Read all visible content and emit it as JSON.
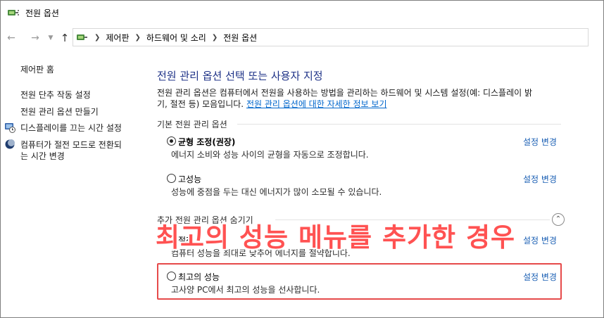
{
  "window": {
    "title": "전원 옵션"
  },
  "breadcrumb": {
    "items": [
      "제어판",
      "하드웨어 및 소리",
      "전원 옵션"
    ]
  },
  "sidebar": {
    "home": "제어판 홈",
    "links": [
      {
        "label": "전원 단추 작동 설정",
        "icon": null
      },
      {
        "label": "전원 관리 옵션 만들기",
        "icon": null
      },
      {
        "label": "디스플레이를 끄는 시간 설정",
        "icon": "display-clock-icon"
      },
      {
        "label": "컴퓨터가 절전 모드로 전환되",
        "label2": "는 시간 변경",
        "icon": "moon-icon"
      }
    ]
  },
  "main": {
    "heading": "전원 관리 옵션 선택 또는 사용자 지정",
    "description_line1": "전원 관리 옵션은 컴퓨터에서 전원을 사용하는 방법을 관리하는 하드웨어 및 시스템 설정(예: 디스플레이 밝",
    "description_line2": "기, 절전 등) 모음입니다.",
    "more_info_link": "전원 관리 옵션에 대한 자세한 정보 보기",
    "basic_group_label": "기본 전원 관리 옵션",
    "hidden_group_label": "추가 전원 관리 옵션 숨기기",
    "change_label": "설정 변경",
    "plans": [
      {
        "name": "균형 조정(권장)",
        "desc": "에너지 소비와 성능 사이의 균형을 자동으로 조정합니다.",
        "selected": true
      },
      {
        "name": "고성능",
        "desc": "성능에 중점을 두는 대신 에너지가 많이 소모될 수 있습니다.",
        "selected": false
      },
      {
        "name": "절전",
        "desc": "컴퓨터 성능을 최대로 낮추어 에너지를 절약합니다.",
        "selected": false
      },
      {
        "name": "최고의 성능",
        "desc": "고사양 PC에서 최고의 성능을 선사합니다.",
        "selected": false
      }
    ]
  },
  "overlay": {
    "caption": "최고의 성능 메뉴를 추가한 경우",
    "caption_color": "#ff5252",
    "highlight_color": "#e64a4a"
  },
  "colors": {
    "heading": "#1e3287",
    "link": "#1a5fb4"
  }
}
